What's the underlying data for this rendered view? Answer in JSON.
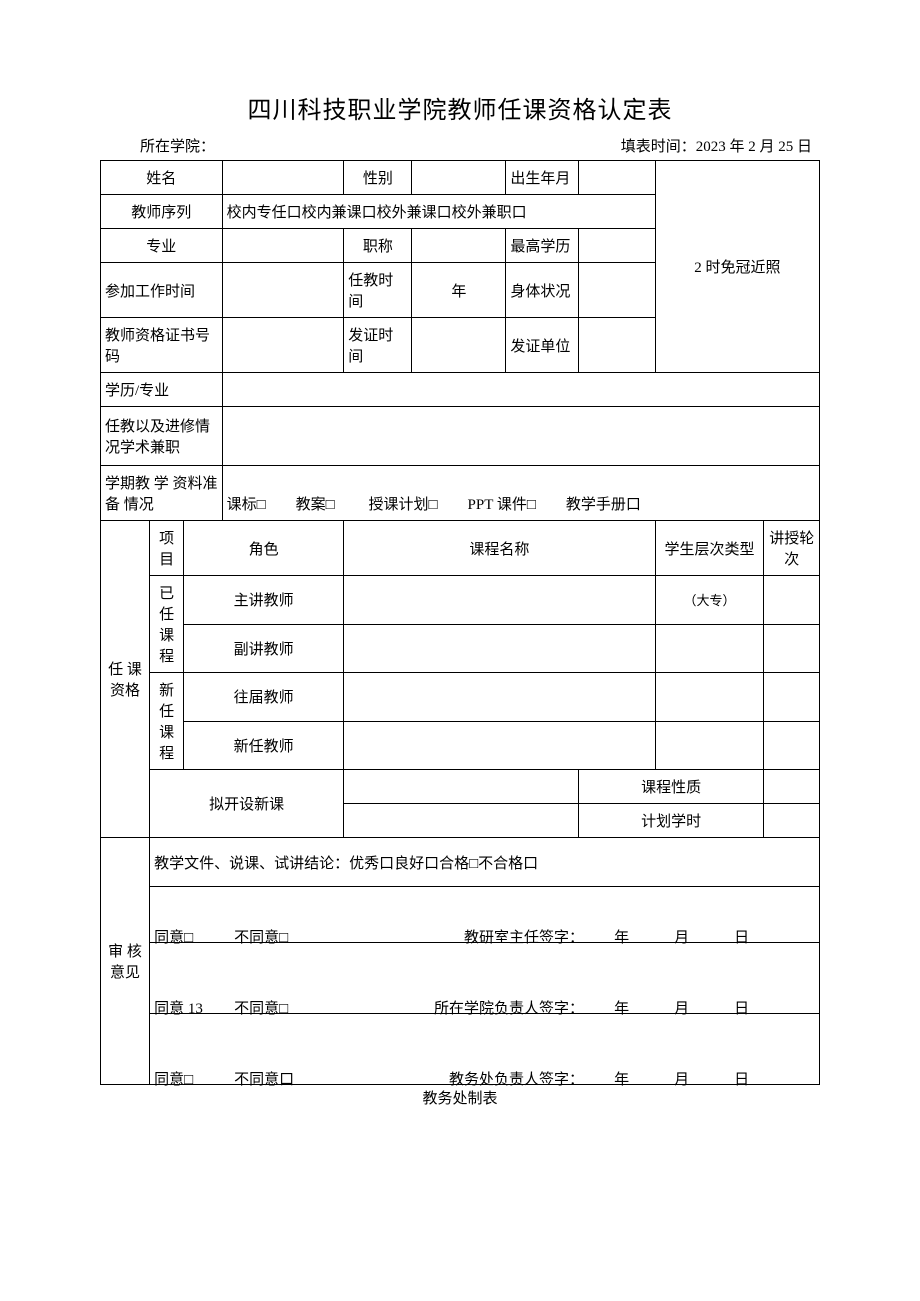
{
  "title": "四川科技职业学院教师任课资格认定表",
  "top": {
    "dept_label": "所在学院：",
    "date_label": "填表时间：",
    "date_value": "2023 年 2 月 25 日"
  },
  "row1": {
    "name": "姓名",
    "gender": "性别",
    "dob": "出生年月"
  },
  "row_seq": {
    "label": "教师序列",
    "opts": "校内专任口校内兼课口校外兼课口校外兼职口"
  },
  "row2": {
    "major": "专业",
    "title": "职称",
    "edu": "最高学历"
  },
  "photo": "2 时免冠近照",
  "row3": {
    "workstart": "参加工作时间",
    "teachtime": "任教时间",
    "teachtime_val": "年",
    "health": "身体状况"
  },
  "row4": {
    "certno": "教师资格证书号码",
    "issuedate": "发证时间",
    "issuer": "发证单位"
  },
  "row5": {
    "label": "学历/专业"
  },
  "row6": {
    "label": "任教以及进修情况学术兼职"
  },
  "row7": {
    "label": "学期教 学 资料准备 情况",
    "opts": "课标□  教案□   授课计划□  PPT 课件□  教学手册口"
  },
  "qual": {
    "side": "任 课资格",
    "hdr": {
      "item": "项目",
      "role": "角色",
      "course": "课程名称",
      "level": "学生层次类型",
      "rounds": "讲授轮次"
    },
    "g1": "已任课程",
    "g2": "新任课程",
    "r1": "主讲教师",
    "r1_level": "（大专）",
    "r2": "副讲教师",
    "r3": "往届教师",
    "r4": "新任教师",
    "newcourse": "拟开设新课",
    "nature": "课程性质",
    "hours": "计划学时"
  },
  "review": {
    "side": "审 核意见",
    "conclusion": "教学文件、说课、试讲结论：优秀口良好口合格□不合格口",
    "agree": "同意□",
    "agree13": "同意 13",
    "agree_sq": "同意□",
    "disagree": "不同意□",
    "disagree_sq": "不同意口",
    "sig1": "教研室主任签字：",
    "sig2": "所在学院负责人签字：",
    "sig3": "教务处负责人签字：",
    "date": "年   月   日"
  },
  "foot": "教务处制表"
}
